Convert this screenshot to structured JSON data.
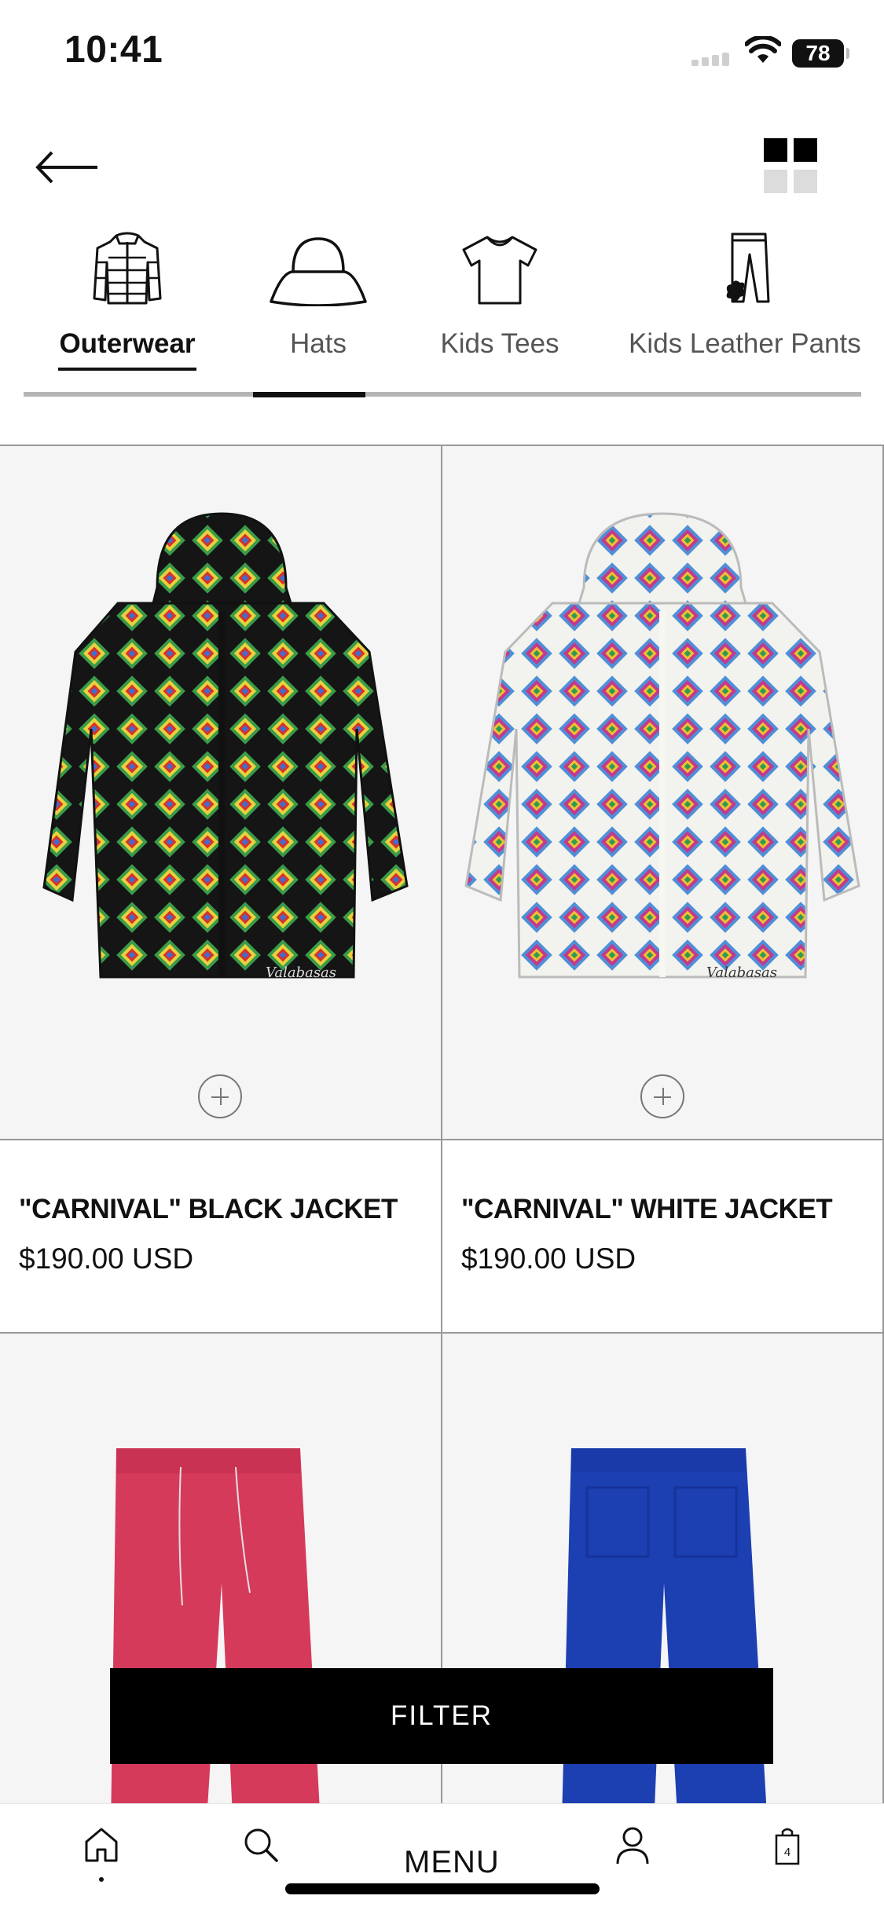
{
  "status_bar": {
    "time": "10:41",
    "battery": "78"
  },
  "categories": [
    {
      "label": "Outerwear",
      "icon": "puffer-jacket-icon",
      "active": true
    },
    {
      "label": "Hats",
      "icon": "bucket-hat-icon",
      "active": false
    },
    {
      "label": "Kids Tees",
      "icon": "tshirt-icon",
      "active": false
    },
    {
      "label": "Kids Leather Pants",
      "icon": "leather-pants-icon",
      "active": false
    }
  ],
  "products": [
    {
      "name": "\"CARNIVAL\" BLACK JACKET",
      "price": "$190.00 USD",
      "base_color": "#161616",
      "image": "black crochet jacket"
    },
    {
      "name": "\"CARNIVAL\" WHITE JACKET",
      "price": "$190.00 USD",
      "base_color": "#eeeeea",
      "image": "white crochet jacket"
    },
    {
      "name": "",
      "price": "",
      "base_color": "#d63a5b",
      "image": "pink sweatpants"
    },
    {
      "name": "",
      "price": "",
      "base_color": "#1c3fb2",
      "image": "blue sweatpants"
    }
  ],
  "filter_label": "FILTER",
  "tabbar": {
    "menu_label": "MENU",
    "cart_count": "4"
  },
  "colors": {
    "accent": "#000000",
    "divider": "#999999",
    "image_bg": "#f5f5f5"
  }
}
